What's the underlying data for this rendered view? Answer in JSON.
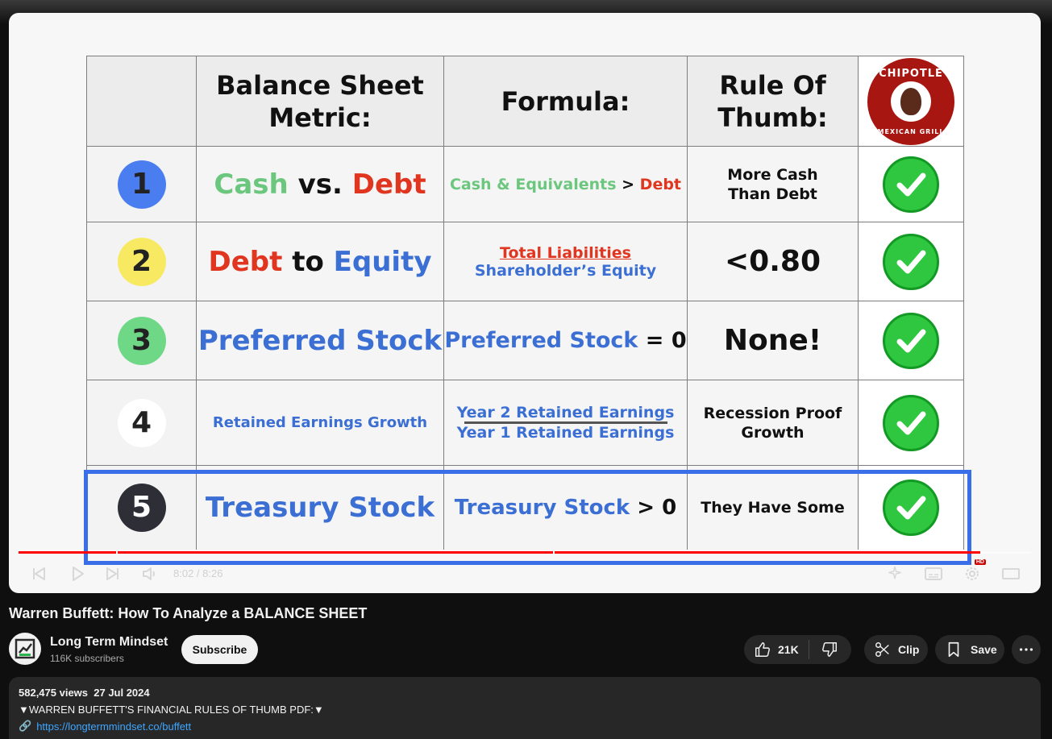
{
  "slide": {
    "headers": [
      "Balance Sheet\nMetric:",
      "Formula:",
      "Rule Of\nThumb:"
    ],
    "logo": {
      "top_text": "CHIPOTLE",
      "bottom_text": "MEXICAN GRILL"
    },
    "rows": [
      {
        "number": "1",
        "metric_a": "Cash",
        "metric_b": " vs. ",
        "metric_c": "Debt",
        "formula_a": "Cash & Equivalents",
        "formula_b": " > ",
        "formula_c": "Debt",
        "rule": "More Cash\nThan Debt"
      },
      {
        "number": "2",
        "metric_a": "Debt",
        "metric_b": " to ",
        "metric_c": "Equity",
        "formula_top": "Total Liabilities",
        "formula_bottom": "Shareholder’s Equity",
        "rule": "<0.80"
      },
      {
        "number": "3",
        "metric": "Preferred Stock",
        "formula_a": "Preferred Stock",
        "formula_b": " = 0",
        "rule": "None!"
      },
      {
        "number": "4",
        "metric": "Retained Earnings Growth",
        "formula_top": "Year 2 Retained Earnings",
        "formula_bottom": "Year 1 Retained Earnings",
        "rule": "Recession Proof\nGrowth"
      },
      {
        "number": "5",
        "metric": "Treasury Stock",
        "formula_a": "Treasury Stock",
        "formula_b": " > 0",
        "rule": "They Have Some"
      }
    ]
  },
  "player": {
    "time": "8:02 / 8:26",
    "chapter": "",
    "progress_fraction": 0.95,
    "hd_badge": "HD"
  },
  "video": {
    "title": "Warren Buffett: How To Analyze a BALANCE SHEET",
    "channel": "Long Term Mindset",
    "subscribers": "116K subscribers",
    "subscribe_label": "Subscribe",
    "likes": "21K",
    "clip_label": "Clip",
    "save_label": "Save"
  },
  "description": {
    "meta": "582,475 views  27 Jul 2024",
    "line1": "▼WARREN BUFFETT'S FINANCIAL RULES OF THUMB PDF:▼",
    "link": "https://longtermmindset.co/buffett"
  },
  "colors": {
    "accent_red": "#ff0000",
    "highlight_blue": "#3a6ee8",
    "link_blue": "#3ea6ff",
    "bg": "#0f0f0f"
  }
}
